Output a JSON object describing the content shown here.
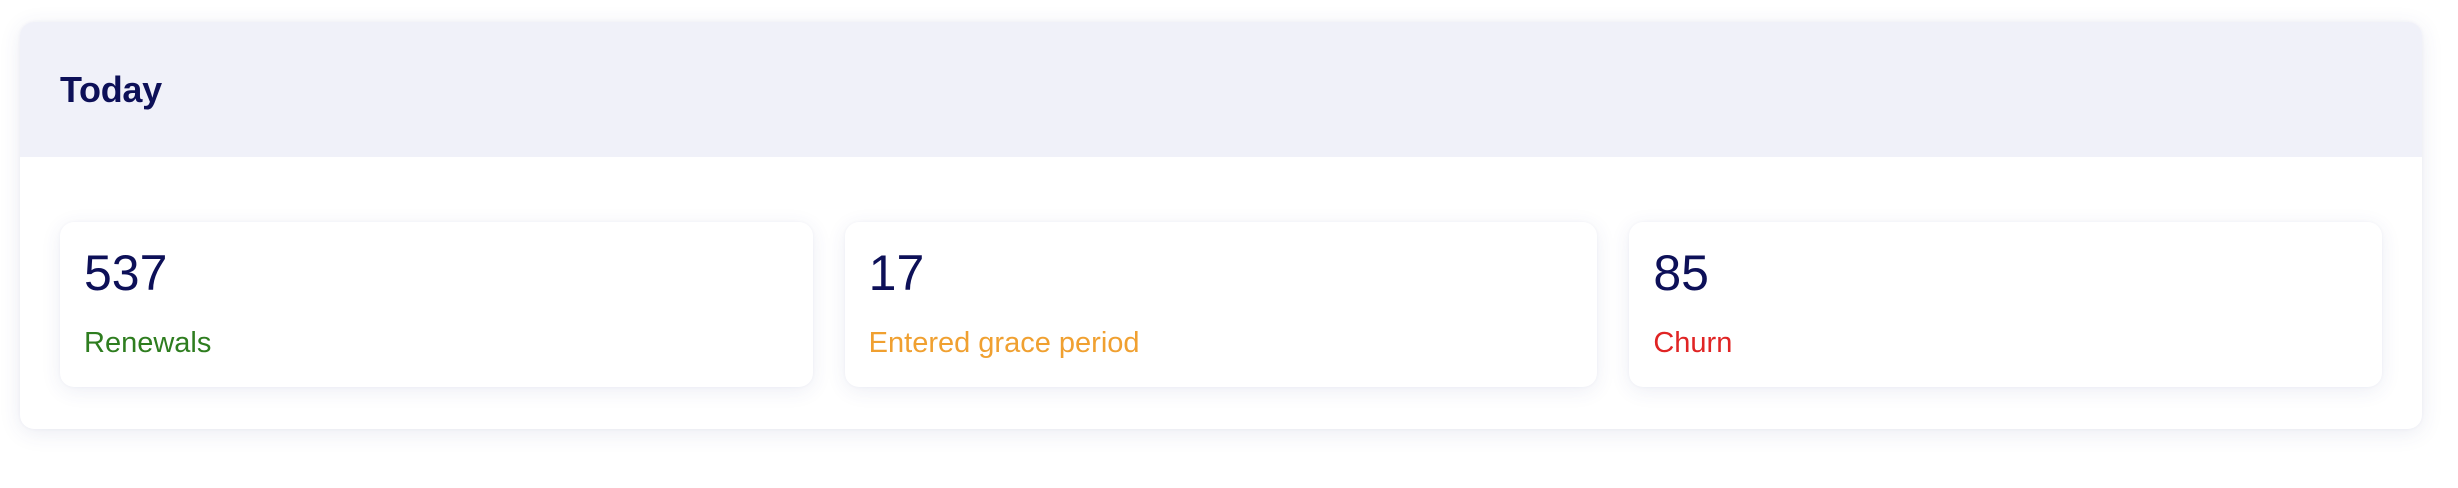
{
  "panel": {
    "title": "Today"
  },
  "stats": [
    {
      "value": "537",
      "label": "Renewals",
      "label_color": "#2e7d1f"
    },
    {
      "value": "17",
      "label": "Entered grace period",
      "label_color": "#f0a030"
    },
    {
      "value": "85",
      "label": "Churn",
      "label_color": "#e02424"
    }
  ],
  "colors": {
    "title": "#0d1058",
    "header_bg": "#f0f1f9"
  }
}
